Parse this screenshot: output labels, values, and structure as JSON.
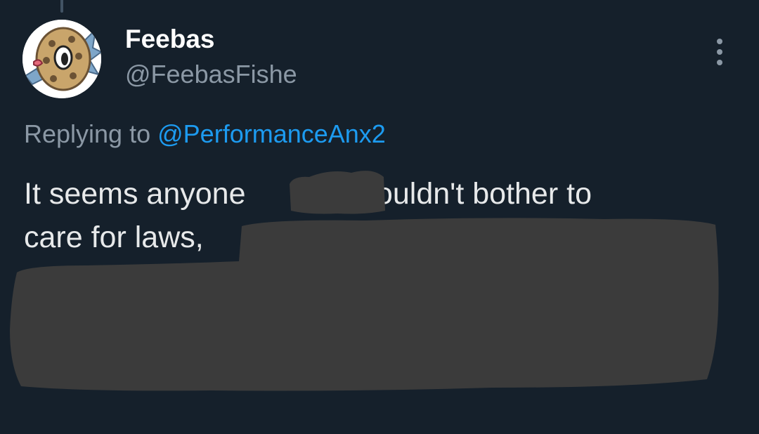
{
  "tweet": {
    "author": {
      "display_name": "Feebas",
      "handle": "@FeebasFishe",
      "avatar_icon": "feebas-avatar"
    },
    "more_icon": "more-vertical-icon",
    "reply": {
      "prefix": "Replying to",
      "mention": "@PerformanceAnx2"
    },
    "text": {
      "line1_part1": "It seems anyone",
      "line1_part2": "shouldn't bother to",
      "line2": "care for laws,"
    },
    "redacted": true
  },
  "colors": {
    "background": "#15202b",
    "primary_text": "#e7e9ea",
    "secondary_text": "#8b98a5",
    "link": "#1d9bf0",
    "redaction": "#3b3b3b"
  }
}
